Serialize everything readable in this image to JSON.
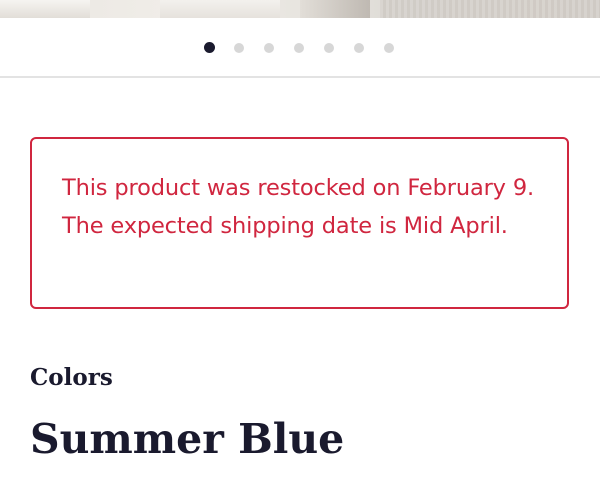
{
  "carousel": {
    "dots": [
      {
        "active": true
      },
      {
        "active": false
      },
      {
        "active": false
      },
      {
        "active": false
      },
      {
        "active": false
      },
      {
        "active": false
      },
      {
        "active": false
      }
    ],
    "active_index": 0,
    "total": 7
  },
  "alert": {
    "line1": "This product was restocked on February 9.",
    "line2": "The expected shipping date is Mid April.",
    "color": "#d0263f"
  },
  "colors": {
    "label": "Colors",
    "selected": "Summer Blue"
  },
  "theme": {
    "text_dark": "#1a1a2e",
    "dot_inactive": "#d7d7d7",
    "divider": "#e3e3e3"
  }
}
